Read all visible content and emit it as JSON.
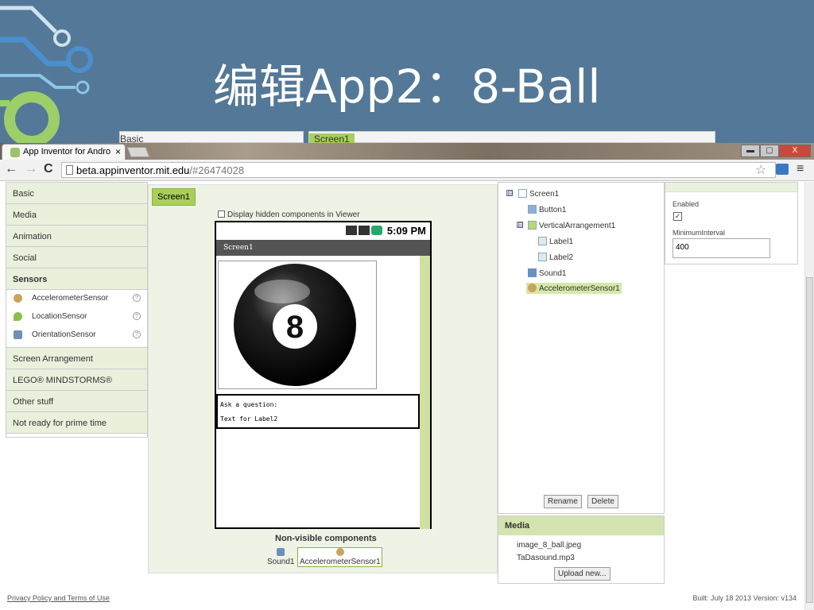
{
  "slide": {
    "title": "编辑App2：8-Ball"
  },
  "behind": {
    "left_text": "Basic",
    "right_text": "Screen1"
  },
  "browser": {
    "tab_title": "App Inventor for Andro",
    "tab_close": "×",
    "url_host": "beta.appinventor.mit.edu",
    "url_rest": "/#26474028",
    "back": "←",
    "forward": "→",
    "reload": "C",
    "star": "☆",
    "menu": "≡",
    "min": "▬",
    "max": "▢",
    "close": "X"
  },
  "palette": {
    "categories_top": [
      "Basic",
      "Media",
      "Animation",
      "Social"
    ],
    "sensors_label": "Sensors",
    "sensor_items": [
      {
        "label": "AccelerometerSensor",
        "icon": "accelerometer-icon"
      },
      {
        "label": "LocationSensor",
        "icon": "location-icon"
      },
      {
        "label": "OrientationSensor",
        "icon": "orientation-icon"
      }
    ],
    "help": "?",
    "categories_bottom": [
      "Screen Arrangement",
      "LEGO® MINDSTORMS®",
      "Other stuff",
      "Not ready for prime time"
    ]
  },
  "viewer": {
    "screen_tab": "Screen1",
    "hidden_checkbox_label": "Display hidden components in Viewer",
    "status_time": "5:09 PM",
    "app_title": "Screen1",
    "ball_number": "8",
    "label1": "Ask a question:",
    "label2": "Text for Label2",
    "nonvisible_title": "Non-visible components",
    "nonvisible": [
      {
        "label": "Sound1"
      },
      {
        "label": "AccelerometerSensor1"
      }
    ]
  },
  "tree": {
    "toggle": "⊟",
    "nodes": [
      "Screen1",
      "Button1",
      "VerticalArrangement1",
      "Label1",
      "Label2",
      "Sound1",
      "AccelerometerSensor1"
    ],
    "rename": "Rename",
    "delete": "Delete"
  },
  "media": {
    "title": "Media",
    "files": [
      "image_8_ball.jpeg",
      "TaDasound.mp3"
    ],
    "upload": "Upload new..."
  },
  "properties": {
    "enabled_label": "Enabled",
    "enabled_check": "✓",
    "interval_label": "MinimumInterval",
    "interval_value": "400"
  },
  "footer": {
    "privacy": "Privacy Policy and Terms of Use",
    "build": "Built: July 18 2013 Version: v134"
  },
  "colors": {
    "slide_bg": "#547897",
    "accent_green": "#a9cf5a",
    "selected_bg": "#d6e8a8"
  }
}
